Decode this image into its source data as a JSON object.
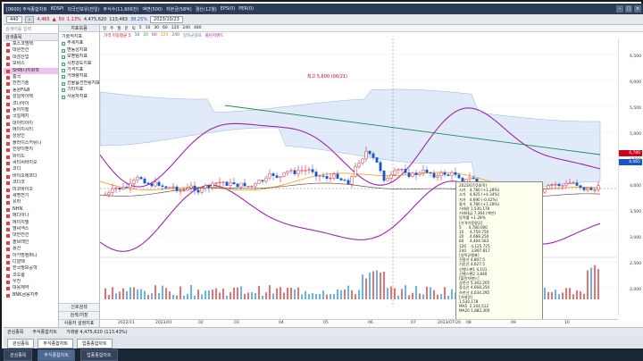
{
  "window": {
    "title_items": [
      "[0600] 주식종합차트",
      "KOSPI",
      "외국인보유(전일)",
      "주식수(11,606천)",
      "액면(500)",
      "자본금(58억)",
      "결산(12월)",
      "EPS(0)",
      "PER(0)"
    ]
  },
  "toolbar": {
    "code": "440",
    "price": "4,465",
    "change_arrow": "▲",
    "change": "50",
    "pct": "1.13%",
    "volume": "4,475,620",
    "volume2": "113,483",
    "ratio": "38.25%",
    "date": "2023/10/23"
  },
  "left_panel": {
    "search_placeholder": "검색어를 입력",
    "header": "검색종목",
    "items": [
      "포스코엠텍",
      "대원전선",
      "대성산업",
      "모비스",
      "SH에너지화학",
      "흥국",
      "한전기술",
      "동원F&B",
      "성일하이텍",
      "코나아이",
      "동아지질",
      "국일제지",
      "대아티아이",
      "에이치시티",
      "상상인",
      "플라이스커뮤니",
      "한양이엔지",
      "와이드",
      "씨티씨바이오",
      "코디",
      "바이오에프디",
      "코다코",
      "미코바이오",
      "세명전기",
      "유라",
      "NHN",
      "메디아나",
      "에이치엘",
      "엠씨넥스",
      "대한전선",
      "솔브레인",
      "풍산",
      "아가방컴퍼니",
      "디알텍",
      "한국정보공학",
      "코오롱",
      "우진",
      "대웅제약",
      "BNK금융지주"
    ]
  },
  "mid_panel": {
    "header": "지표모음",
    "items": [
      "기술적지표",
      "추세지표",
      "변동성지표",
      "모멘텀지표",
      "시장강도지표",
      "가격지표",
      "거래량지표",
      "선물옵션전용지표",
      "기타지표",
      "사용자지표"
    ],
    "bottom": [
      "신호검색",
      "검색/저장",
      "사용자 설정지표"
    ]
  },
  "chart_header": {
    "items": [
      "일",
      "주",
      "월",
      "분",
      "틱",
      "5",
      "10",
      "30",
      "60",
      "120",
      "240",
      "480"
    ],
    "legend": [
      "가격 이동평균 5",
      "10",
      "20",
      "60",
      "120",
      "240",
      "일목균형표",
      "볼린저밴드"
    ],
    "high_label": "최고 5,600 (06/21)",
    "low_label": "최저 2,940"
  },
  "price_axis": [
    "6,500",
    "6,000",
    "5,500",
    "5,000",
    "4,500",
    "4,000",
    "3,500",
    "3,000",
    "2,500",
    "2,000"
  ],
  "price_tags": [
    {
      "label": "4,780",
      "color": "#d0021b"
    },
    {
      "label": "4,465",
      "color": "#1a55c8"
    }
  ],
  "info_box": {
    "rows": [
      "2023/07/20(목)",
      "시가   4,780 (+1.28%)",
      "고가   4,925 (+4.34%)",
      "저가   4,690 (-0.42%)",
      "종가   4,780 (+1.28%)",
      "거래량 1,530,178",
      "거래대금 7,364 (백만)",
      "등락률 +1.28%",
      "[가격이동평균]",
      "5      4,780.000",
      "10     4,759.750",
      "20     4,668.250",
      "60     4,404.583",
      "120    4,125.725",
      "240    3,897.817",
      "[일목균형표]",
      "전환선 4,807.5",
      "기준선 4,627.5",
      "선행스팬1 4,101",
      "선행스팬2 3,840",
      "[볼린저밴드]",
      "상한선 5,302.205",
      "중심선 4,668.250",
      "하한선 4,034.295",
      "[거래량]",
      "1,530,178",
      "MA5  2,104,512",
      "MA20 1,882,300"
    ]
  },
  "date_axis": [
    "2022/11",
    "2023/01",
    "02",
    "03",
    "04",
    "05",
    "06",
    "07",
    "2023/07/20",
    "08",
    "09",
    "10"
  ],
  "volume_label": "거래량 4,475,620 (113.43%)",
  "statusbar": [
    "관심종목",
    "주식종합차트"
  ],
  "tabs": [
    "관심종목",
    "주식종합차트",
    "업종종합차트"
  ],
  "taskbar": [
    "관심종목",
    "주식종합차트",
    "업종종합차트"
  ]
}
